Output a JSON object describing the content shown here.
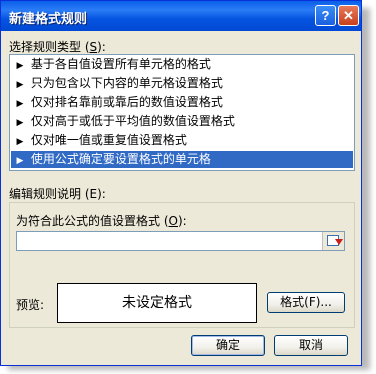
{
  "window": {
    "title": "新建格式规则",
    "help_label": "?",
    "close_label": "✕"
  },
  "rule_type": {
    "label_text": "选择规则类型 (",
    "label_key": "S",
    "label_end": "):",
    "items": [
      {
        "label": "基于各自值设置所有单元格的格式",
        "selected": false
      },
      {
        "label": "只为包含以下内容的单元格设置格式",
        "selected": false
      },
      {
        "label": "仅对排名靠前或靠后的数值设置格式",
        "selected": false
      },
      {
        "label": "仅对高于或低于平均值的数值设置格式",
        "selected": false
      },
      {
        "label": "仅对唯一值或重复值设置格式",
        "selected": false
      },
      {
        "label": "使用公式确定要设置格式的单元格",
        "selected": true
      }
    ]
  },
  "edit_rule": {
    "label": "编辑规则说明 (E):",
    "formula_label_text": "为符合此公式的值设置格式 (",
    "formula_label_key": "O",
    "formula_label_end": "):",
    "formula_value": "",
    "preview_label": "预览:",
    "preview_text": "未设定格式",
    "format_button": "格式(F)..."
  },
  "buttons": {
    "ok": "确定",
    "cancel": "取消"
  },
  "colors": {
    "title_bar": "#0554e1",
    "selection": "#316ac5",
    "dialog_bg": "#ece9d8"
  }
}
